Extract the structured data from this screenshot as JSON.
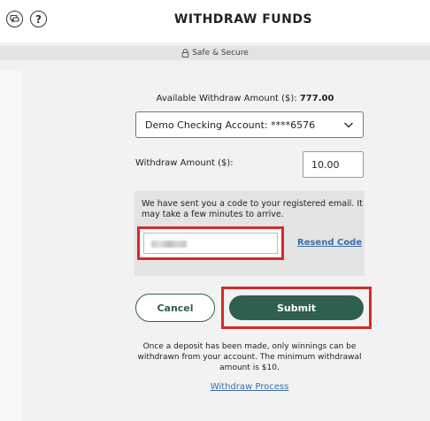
{
  "header": {
    "title": "WITHDRAW FUNDS",
    "help_glyph": "?"
  },
  "secure_bar": {
    "label": "Safe & Secure"
  },
  "form": {
    "available_label": "Available Withdraw Amount ($): ",
    "available_value": "777.00",
    "account_selected": "Demo Checking Account: ****6576",
    "amount_label": "Withdraw Amount ($):",
    "amount_value": "10.00",
    "code_message": "We have sent you a code to your registered email. It may take a few minutes to arrive.",
    "resend_label": "Resend Code",
    "cancel_label": "Cancel",
    "submit_label": "Submit",
    "note": "Once a deposit has been made, only winnings can be withdrawn from your account. The minimum withdrawal amount is $10.",
    "process_link": "Withdraw Process"
  },
  "colors": {
    "brand_green": "#2f5f50",
    "highlight_red": "#d32b2b",
    "link_blue": "#3a6ea8"
  }
}
